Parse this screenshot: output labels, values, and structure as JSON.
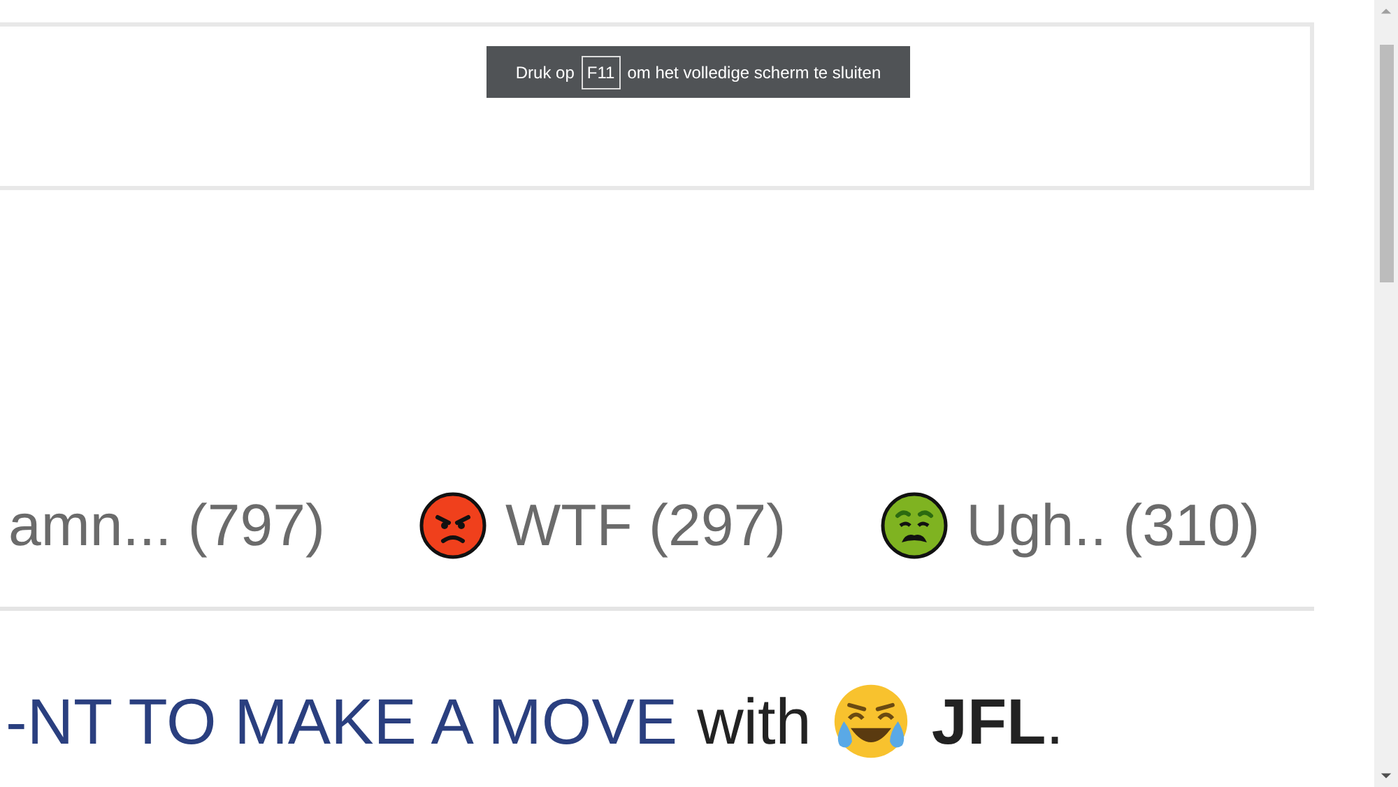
{
  "fullscreen_notice": {
    "before": "Druk op",
    "key": "F11",
    "after": "om het volledige scherm te sluiten"
  },
  "reactions": [
    {
      "kind": "none",
      "label": "amn... (797)"
    },
    {
      "kind": "angry",
      "label": "WTF (297)"
    },
    {
      "kind": "sick",
      "label": "Ugh.. (310)"
    }
  ],
  "headline": {
    "link": "-NT TO MAKE A MOVE",
    "middle": "with",
    "kind": "laughing",
    "end": "**JFL**."
  }
}
